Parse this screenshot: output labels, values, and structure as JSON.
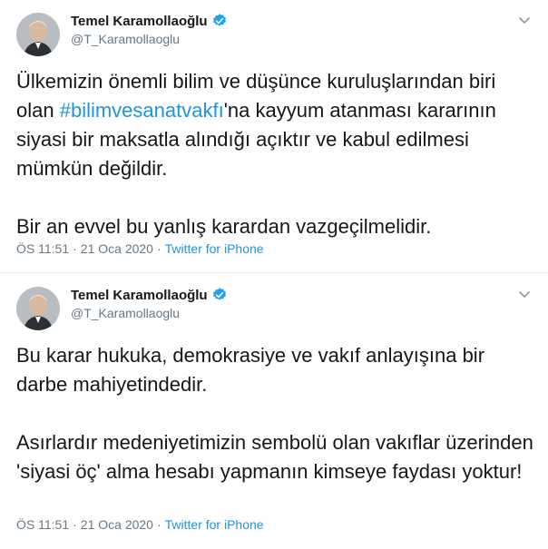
{
  "tweets": [
    {
      "author": {
        "name": "Temel Karamollaoğlu",
        "handle": "@T_Karamollaoglu"
      },
      "text": {
        "before_hashtag": "Ülkemizin önemli bilim ve düşünce kuruluşlarından biri olan ",
        "hashtag": "#bilimvesanatvakfı",
        "after_hashtag": "'na kayyum atanması kararının siyasi bir maksatla alındığı açıktır ve kabul edilmesi mümkün değildir.\n\nBir an evvel bu yanlış karardan vazgeçilmelidir."
      },
      "time": "ÖS 11:51",
      "separator": "·",
      "date": "21 Oca 2020",
      "source": "Twitter for iPhone"
    },
    {
      "author": {
        "name": "Temel Karamollaoğlu",
        "handle": "@T_Karamollaoglu"
      },
      "text": "Bu karar hukuka, demokrasiye ve vakıf anlayışına bir darbe mahiyetindedir.\n\nAsırlardır medeniyetimizin sembolü olan vakıflar üzerinden 'siyasi öç' alma hesabı yapmanın kimseye faydası yoktur!",
      "time": "ÖS 11:51",
      "separator": "·",
      "date": "21 Oca 2020",
      "source": "Twitter for iPhone"
    }
  ],
  "colors": {
    "link": "#1b95e0",
    "muted": "#657786",
    "text": "#14171a",
    "verified": "#1da1f2"
  },
  "icons": {
    "verified": "verified-badge-icon",
    "menu": "chevron-down-icon"
  }
}
